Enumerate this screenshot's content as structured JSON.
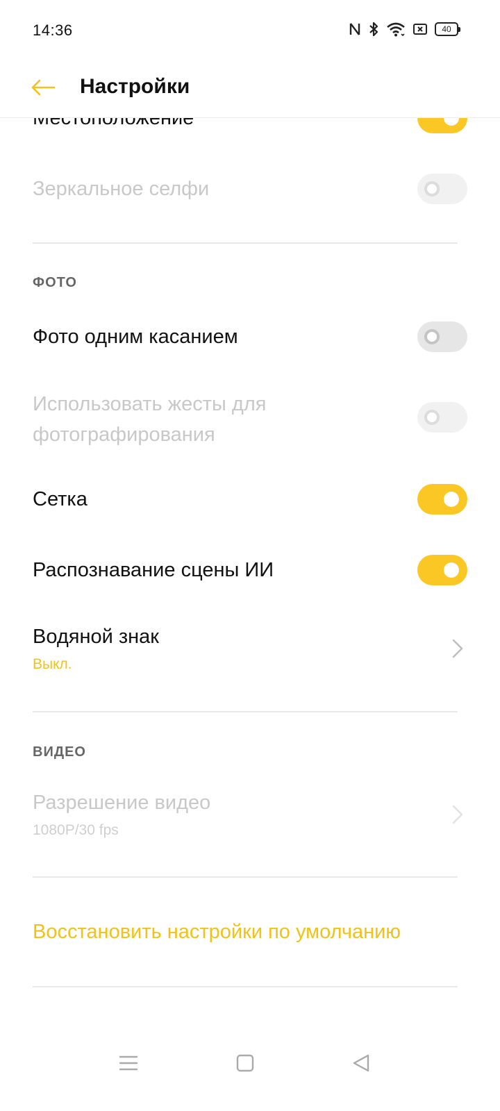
{
  "status_bar": {
    "time": "14:36",
    "battery": "40"
  },
  "header": {
    "title": "Настройки"
  },
  "settings": {
    "location": {
      "label": "Местоположение",
      "state": "on"
    },
    "mirror_selfie": {
      "label": "Зеркальное селфи",
      "state": "off",
      "enabled": false
    },
    "photo_section": {
      "title": "ФОТО"
    },
    "one_touch_photo": {
      "label": "Фото одним касанием",
      "state": "off"
    },
    "gesture_photo": {
      "label_line1": "Использовать жесты для",
      "label_line2": "фотографирования",
      "state": "off",
      "enabled": false
    },
    "grid": {
      "label": "Сетка",
      "state": "on"
    },
    "ai_scene": {
      "label": "Распознавание сцены ИИ",
      "state": "on"
    },
    "watermark": {
      "label": "Водяной знак",
      "value": "Выкл."
    },
    "video_section": {
      "title": "ВИДЕО"
    },
    "video_resolution": {
      "label": "Разрешение видео",
      "value": "1080P/30 fps",
      "enabled": false
    },
    "reset": {
      "label": "Восстановить настройки по умолчанию"
    }
  },
  "colors": {
    "accent": "#fbc724",
    "accent_text": "#f0c21a",
    "disabled_text": "#c8c8c8"
  },
  "nav": {
    "icons": [
      "menu-icon",
      "home-square-icon",
      "back-triangle-icon"
    ]
  }
}
